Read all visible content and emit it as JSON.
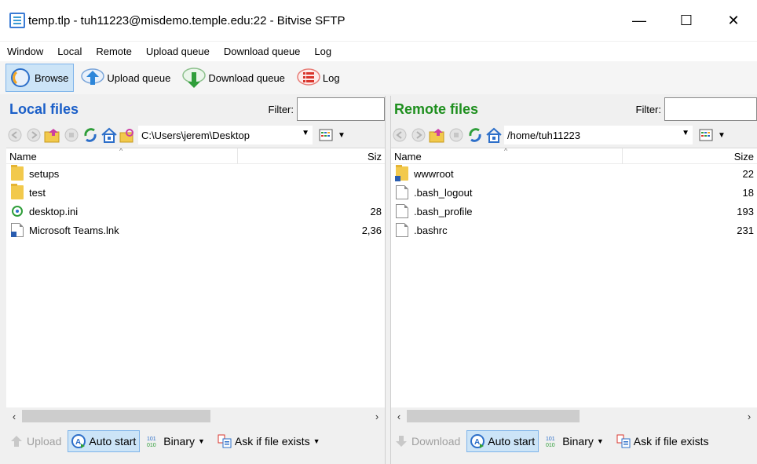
{
  "window": {
    "title": "temp.tlp - tuh11223@misdemo.temple.edu:22 - Bitvise SFTP",
    "minimize": "—",
    "maximize": "☐",
    "close": "✕"
  },
  "menu": [
    "Window",
    "Local",
    "Remote",
    "Upload queue",
    "Download queue",
    "Log"
  ],
  "toolbar": {
    "browse": "Browse",
    "upload_queue": "Upload queue",
    "download_queue": "Download queue",
    "log": "Log"
  },
  "local": {
    "title": "Local files",
    "filter_label": "Filter:",
    "filter_value": "",
    "path": "C:\\Users\\jerem\\Desktop",
    "col_name": "Name",
    "col_size": "Siz",
    "files": [
      {
        "name": "setups",
        "size": "",
        "type": "folder"
      },
      {
        "name": "test",
        "size": "",
        "type": "folder"
      },
      {
        "name": "desktop.ini",
        "size": "28",
        "type": "ini"
      },
      {
        "name": "Microsoft Teams.lnk",
        "size": "2,36",
        "type": "link"
      }
    ],
    "upload": "Upload",
    "auto_start": "Auto start",
    "binary": "Binary",
    "ask_if_exists": "Ask if file exists"
  },
  "remote": {
    "title": "Remote files",
    "filter_label": "Filter:",
    "filter_value": "",
    "path": "/home/tuh11223",
    "col_name": "Name",
    "col_size": "Size",
    "files": [
      {
        "name": "wwwroot",
        "size": "22",
        "type": "folder-link"
      },
      {
        "name": ".bash_logout",
        "size": "18",
        "type": "file"
      },
      {
        "name": ".bash_profile",
        "size": "193",
        "type": "file"
      },
      {
        "name": ".bashrc",
        "size": "231",
        "type": "file"
      }
    ],
    "download": "Download",
    "auto_start": "Auto start",
    "binary": "Binary",
    "ask_if_exists": "Ask if file exists"
  },
  "colors": {
    "local_title": "#1b5fc8",
    "remote_title": "#1e8f1e",
    "active_button": "#cce4f7"
  }
}
